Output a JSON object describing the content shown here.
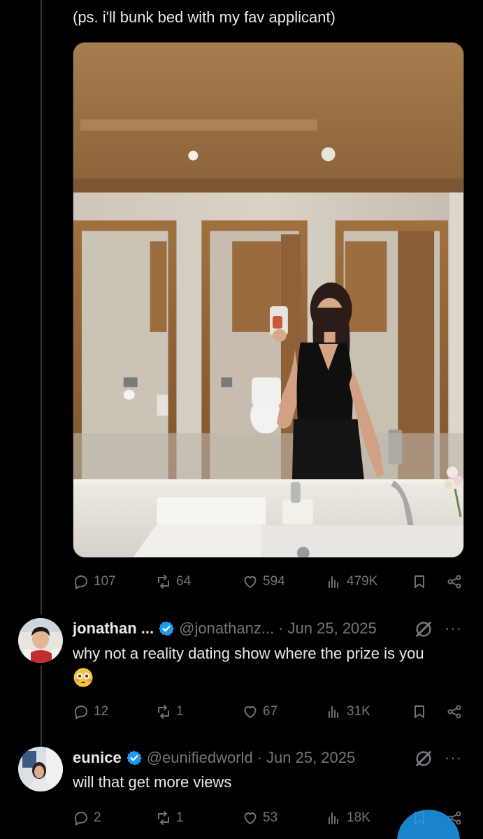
{
  "post": {
    "text": "(ps. i'll bunk bed with my fav applicant)",
    "media_alt": "mirror selfie in a restroom",
    "actions": {
      "replies": "107",
      "reposts": "64",
      "likes": "594",
      "views": "479K"
    }
  },
  "replies": [
    {
      "name": "jonathan ...",
      "handle": "@jonathanz...",
      "separator": "·",
      "date": "Jun 25, 2025",
      "more": "···",
      "text": "why not a reality dating show where the prize is you",
      "emoji": "flushed-face",
      "actions": {
        "replies": "12",
        "reposts": "1",
        "likes": "67",
        "views": "31K"
      }
    },
    {
      "name": "eunice",
      "handle": "@eunifiedworld",
      "separator": "·",
      "date": "Jun 25, 2025",
      "more": "···",
      "text": "will that get more views",
      "actions": {
        "replies": "2",
        "reposts": "1",
        "likes": "53",
        "views": "18K"
      }
    }
  ],
  "colors": {
    "background": "#000000",
    "text": "#e7e9ea",
    "muted": "#71767b",
    "verified": "#1d9bf0"
  }
}
